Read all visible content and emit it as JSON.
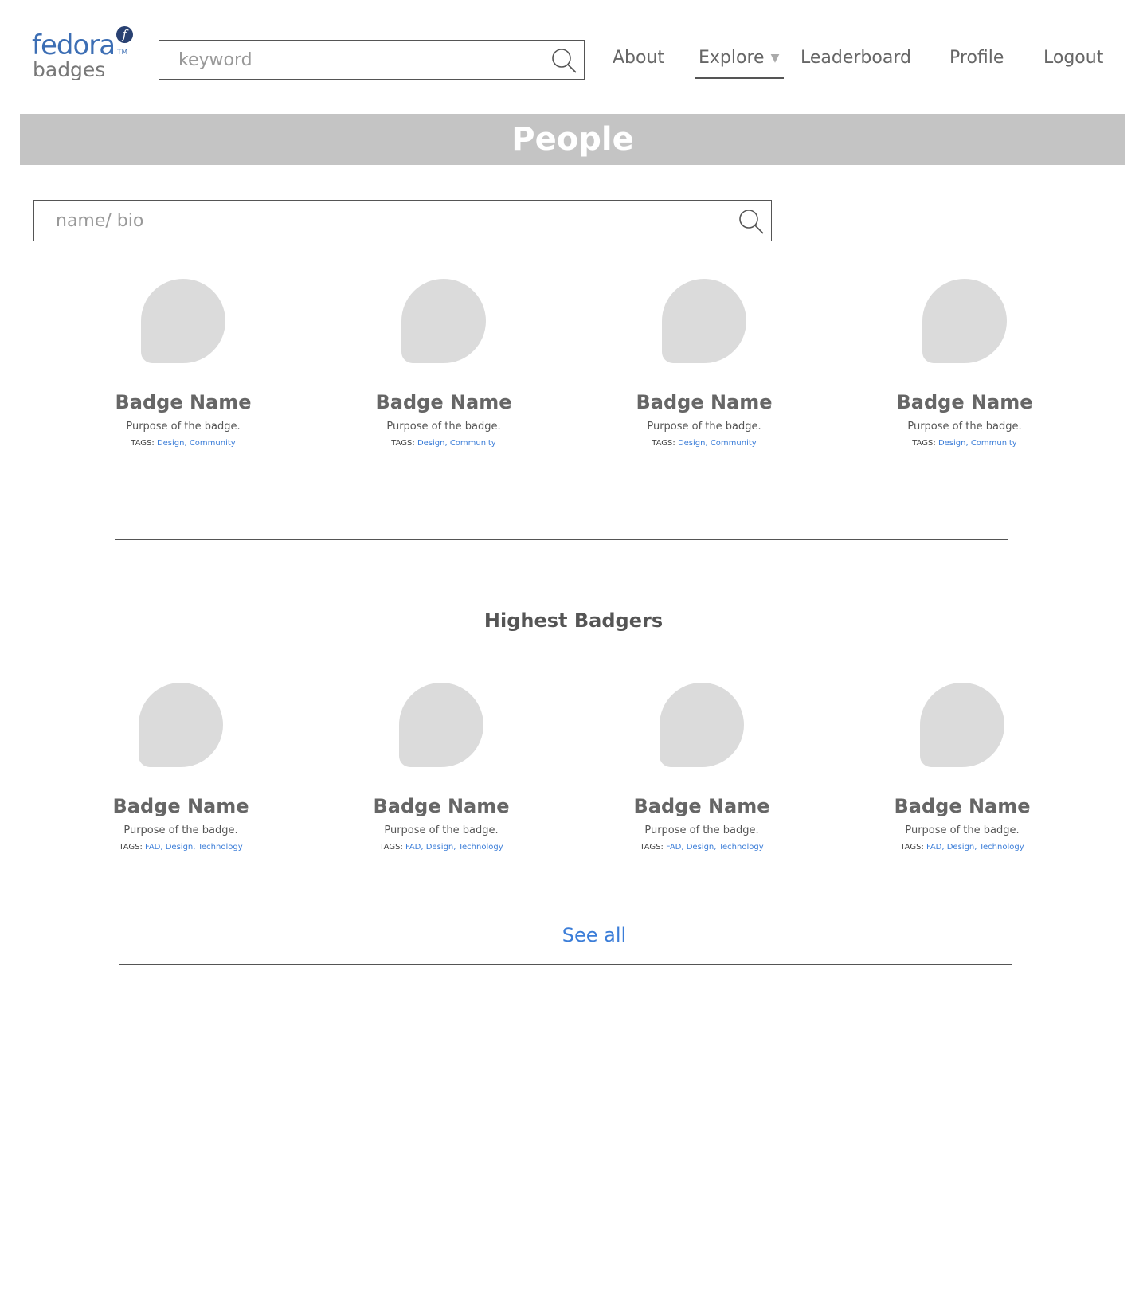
{
  "header": {
    "logo": {
      "wordmark": "fedora",
      "trademark": "TM",
      "product": "badges",
      "mark": "f"
    },
    "search": {
      "placeholder": "keyword"
    },
    "nav": {
      "about": "About",
      "explore": "Explore",
      "leaderboard": "Leaderboard",
      "profile": "Profile",
      "logout": "Logout",
      "active": "Explore"
    }
  },
  "page": {
    "title": "People",
    "search": {
      "placeholder": "name/ bio"
    }
  },
  "people": [
    {
      "name": "Badge Name",
      "purpose": "Purpose of the badge.",
      "tags_label": "TAGS:",
      "tags": "Design, Community"
    },
    {
      "name": "Badge Name",
      "purpose": "Purpose of the badge.",
      "tags_label": "TAGS:",
      "tags": "Design, Community"
    },
    {
      "name": "Badge Name",
      "purpose": "Purpose of the badge.",
      "tags_label": "TAGS:",
      "tags": "Design, Community"
    },
    {
      "name": "Badge Name",
      "purpose": "Purpose of the badge.",
      "tags_label": "TAGS:",
      "tags": "Design, Community"
    }
  ],
  "highest_badgers": {
    "title": "Highest Badgers",
    "items": [
      {
        "name": "Badge Name",
        "purpose": "Purpose of the badge.",
        "tags_label": "TAGS:",
        "tags": "FAD, Design, Technology"
      },
      {
        "name": "Badge Name",
        "purpose": "Purpose of the badge.",
        "tags_label": "TAGS:",
        "tags": "FAD, Design, Technology"
      },
      {
        "name": "Badge Name",
        "purpose": "Purpose of the badge.",
        "tags_label": "TAGS:",
        "tags": "FAD, Design, Technology"
      },
      {
        "name": "Badge Name",
        "purpose": "Purpose of the badge.",
        "tags_label": "TAGS:",
        "tags": "FAD, Design, Technology"
      }
    ],
    "see_all": "See all"
  },
  "colors": {
    "link": "#3b7dd8",
    "fedora_blue": "#3c6eb4",
    "banner": "#c4c4c4",
    "placeholder_badge": "#dbdbdb"
  }
}
